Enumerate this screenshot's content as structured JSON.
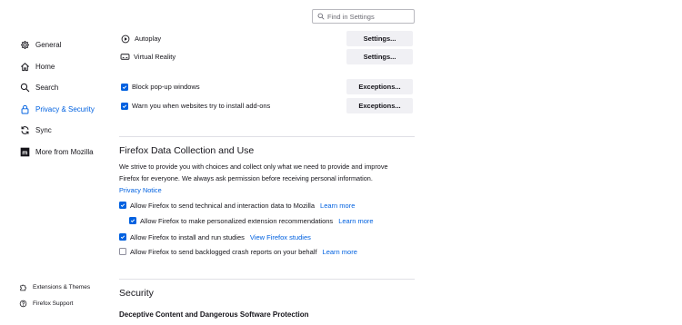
{
  "search": {
    "placeholder": "Find in Settings"
  },
  "nav": {
    "items": [
      {
        "label": "General"
      },
      {
        "label": "Home"
      },
      {
        "label": "Search"
      },
      {
        "label": "Privacy & Security"
      },
      {
        "label": "Sync"
      },
      {
        "label": "More from Mozilla"
      }
    ],
    "bottom": [
      {
        "label": "Extensions & Themes"
      },
      {
        "label": "Firefox Support"
      }
    ]
  },
  "permissions": {
    "autoplay": {
      "label": "Autoplay",
      "button": "Settings..."
    },
    "vr": {
      "label": "Virtual Reality",
      "button": "Settings..."
    },
    "popups": {
      "label": "Block pop-up windows",
      "button": "Exceptions...",
      "checked": true
    },
    "addons": {
      "label": "Warn you when websites try to install add-ons",
      "button": "Exceptions...",
      "checked": true
    }
  },
  "data_collection": {
    "title": "Firefox Data Collection and Use",
    "description": "We strive to provide you with choices and collect only what we need to provide and improve Firefox for everyone. We always ask permission before receiving personal information.",
    "privacy_notice": "Privacy Notice",
    "options": [
      {
        "label": "Allow Firefox to send technical and interaction data to Mozilla",
        "link": "Learn more",
        "checked": true
      },
      {
        "label": "Allow Firefox to make personalized extension recommendations",
        "link": "Learn more",
        "checked": true
      },
      {
        "label": "Allow Firefox to install and run studies",
        "link": "View Firefox studies",
        "checked": true
      },
      {
        "label": "Allow Firefox to send backlogged crash reports on your behalf",
        "link": "Learn more",
        "checked": false
      }
    ]
  },
  "security": {
    "title": "Security",
    "subtitle": "Deceptive Content and Dangerous Software Protection"
  }
}
